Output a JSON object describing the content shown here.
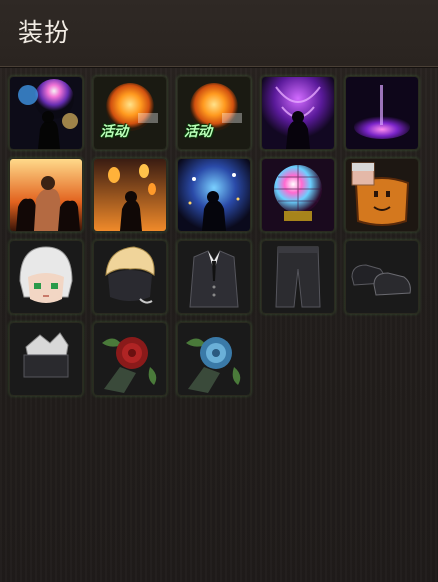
{
  "header": {
    "title": "装扮"
  },
  "items": [
    {
      "id": "fireworks-effect",
      "tag": ""
    },
    {
      "id": "sun-effect-1",
      "tag": "活动"
    },
    {
      "id": "sun-effect-2",
      "tag": "活动"
    },
    {
      "id": "purple-aura-effect",
      "tag": ""
    },
    {
      "id": "purple-ring-effect",
      "tag": ""
    },
    {
      "id": "fire-heroes-effect",
      "tag": ""
    },
    {
      "id": "lanterns-effect",
      "tag": ""
    },
    {
      "id": "blue-sparkle-effect",
      "tag": ""
    },
    {
      "id": "disco-ball-effect",
      "tag": ""
    },
    {
      "id": "avatar-frame-box",
      "tag": ""
    },
    {
      "id": "white-hair-head",
      "tag": ""
    },
    {
      "id": "blonde-chibi-head",
      "tag": ""
    },
    {
      "id": "black-suit",
      "tag": ""
    },
    {
      "id": "black-pants",
      "tag": ""
    },
    {
      "id": "black-shoes",
      "tag": ""
    },
    {
      "id": "pocket-square",
      "tag": ""
    },
    {
      "id": "red-rose",
      "tag": ""
    },
    {
      "id": "blue-rose",
      "tag": ""
    }
  ],
  "colors": {
    "slot_border": "#3b7a3a",
    "tag_text": "#b9ffb9",
    "title_text": "#f2ece4"
  }
}
